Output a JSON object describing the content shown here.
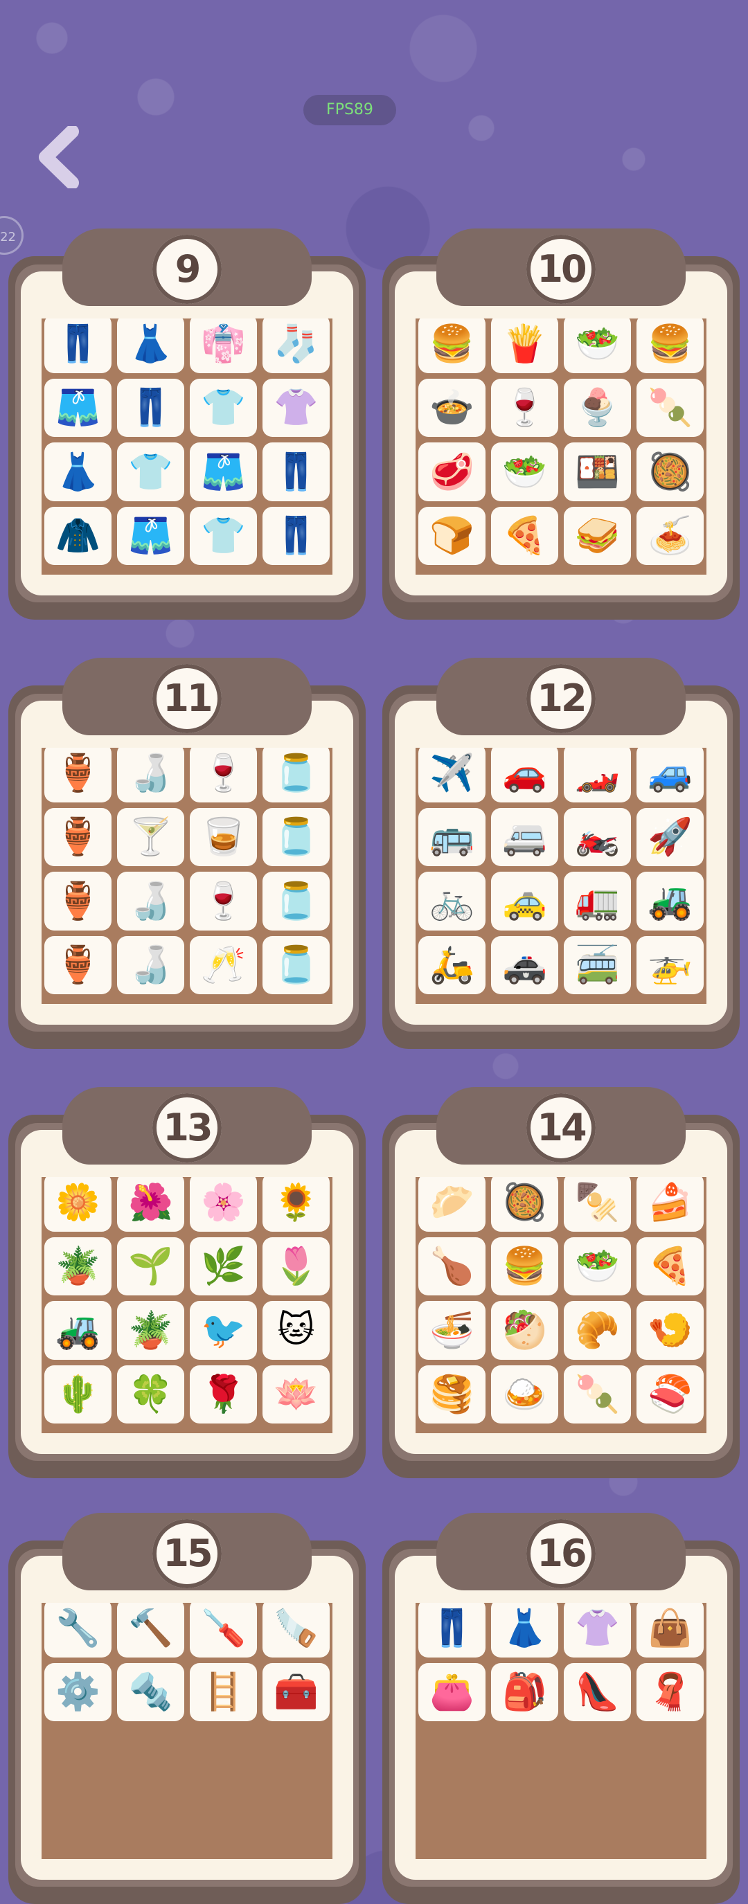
{
  "hud": {
    "fps_label": "FPS89",
    "side_badge": "22"
  },
  "colors": {
    "background": "#7466ab",
    "card_border": "#6f5d57",
    "card_panel": "#faf3e6",
    "tile_bg": "#a97c5f",
    "fps_text": "#7de07a"
  },
  "icons": {
    "back": "chevron-left-icon"
  },
  "levels": [
    {
      "number": "9",
      "theme": "clothing",
      "emojis": [
        "👖",
        "👗",
        "👘",
        "🧦",
        "🩳",
        "👖",
        "👕",
        "👚",
        "👗",
        "👕",
        "🩳",
        "👖",
        "🧥",
        "🩳",
        "👕",
        "👖"
      ]
    },
    {
      "number": "10",
      "theme": "food",
      "emojis": [
        "🍔",
        "🍟",
        "🥗",
        "🍔",
        "🍲",
        "🍷",
        "🍨",
        "🍡",
        "🥩",
        "🥗",
        "🍱",
        "🥘",
        "🍞",
        "🍕",
        "🥪",
        "🍝"
      ]
    },
    {
      "number": "11",
      "theme": "glassware",
      "emojis": [
        "🏺",
        "🍶",
        "🍷",
        "🫙",
        "🏺",
        "🍸",
        "🥃",
        "🫙",
        "🏺",
        "🍶",
        "🍷",
        "🫙",
        "🏺",
        "🍶",
        "🥂",
        "🫙"
      ]
    },
    {
      "number": "12",
      "theme": "vehicles",
      "emojis": [
        "✈️",
        "🚗",
        "🏎️",
        "🚙",
        "🚌",
        "🚐",
        "🏍️",
        "🚀",
        "🚲",
        "🚕",
        "🚛",
        "🚜",
        "🛵",
        "🚓",
        "🚎",
        "🚁"
      ]
    },
    {
      "number": "13",
      "theme": "plants",
      "emojis": [
        "🌼",
        "🌺",
        "🌸",
        "🌻",
        "🪴",
        "🌱",
        "🌿",
        "🌷",
        "🚜",
        "🪴",
        "🐦",
        "🐱",
        "🌵",
        "🍀",
        "🌹",
        "🪷"
      ]
    },
    {
      "number": "14",
      "theme": "dishes",
      "emojis": [
        "🥟",
        "🥘",
        "🍢",
        "🍰",
        "🍗",
        "🍔",
        "🥗",
        "🍕",
        "🍜",
        "🥙",
        "🥐",
        "🍤",
        "🥞",
        "🍛",
        "🍡",
        "🍣"
      ]
    },
    {
      "number": "15",
      "theme": "tools",
      "emojis": [
        "🔧",
        "🔨",
        "🪛",
        "🪚",
        "⚙️",
        "🔩",
        "🪜",
        "🧰"
      ]
    },
    {
      "number": "16",
      "theme": "fashion",
      "emojis": [
        "👖",
        "👗",
        "👚",
        "👜",
        "👛",
        "🎒",
        "👠",
        "🧣"
      ]
    }
  ]
}
